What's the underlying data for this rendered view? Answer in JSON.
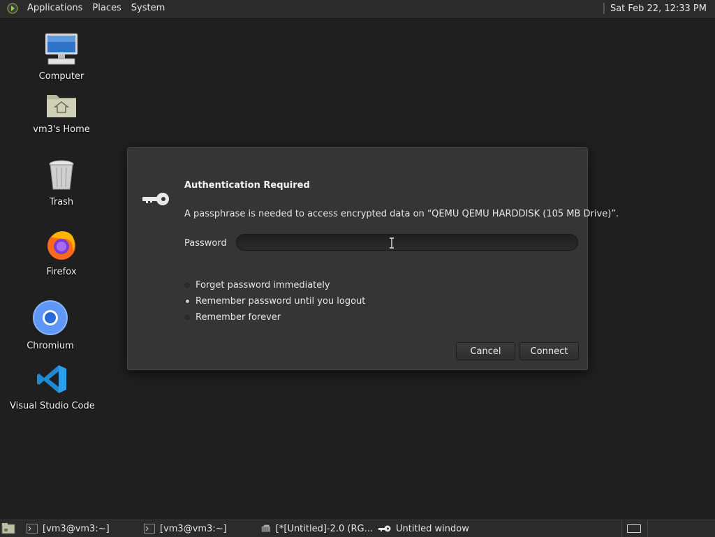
{
  "top_panel": {
    "menus": [
      "Applications",
      "Places",
      "System"
    ],
    "clock": "Sat Feb 22, 12:33 PM"
  },
  "desktop": {
    "icons": [
      {
        "label": "Computer",
        "icon": "computer-icon"
      },
      {
        "label": "vm3's Home",
        "icon": "home-folder-icon"
      },
      {
        "label": "Trash",
        "icon": "trash-icon"
      },
      {
        "label": "Firefox",
        "icon": "firefox-icon"
      },
      {
        "label": "Chromium",
        "icon": "chromium-icon"
      },
      {
        "label": "Visual Studio Code",
        "icon": "vscode-icon"
      }
    ]
  },
  "dialog": {
    "title": "Authentication Required",
    "message": "A passphrase is needed to access encrypted data on “QEMU QEMU HARDDISK (105 MB Drive)”.",
    "password_label": "Password",
    "password_value": "",
    "options": [
      {
        "label": "Forget password immediately",
        "selected": false
      },
      {
        "label": "Remember password until you logout",
        "selected": true
      },
      {
        "label": "Remember forever",
        "selected": false
      }
    ],
    "cancel_label": "Cancel",
    "connect_label": "Connect"
  },
  "taskbar": {
    "tasks": [
      {
        "label": "[vm3@vm3:~]",
        "icon": "terminal-icon"
      },
      {
        "label": "[vm3@vm3:~]",
        "icon": "terminal-icon"
      },
      {
        "label": "[*[Untitled]-2.0 (RG...",
        "icon": "image-editor-icon"
      },
      {
        "label": "Untitled window",
        "icon": "key-icon"
      }
    ]
  },
  "colors": {
    "desktop_bg": "#1f1f1f",
    "panel_bg": "#2b2b2b",
    "dialog_bg": "#353535"
  }
}
